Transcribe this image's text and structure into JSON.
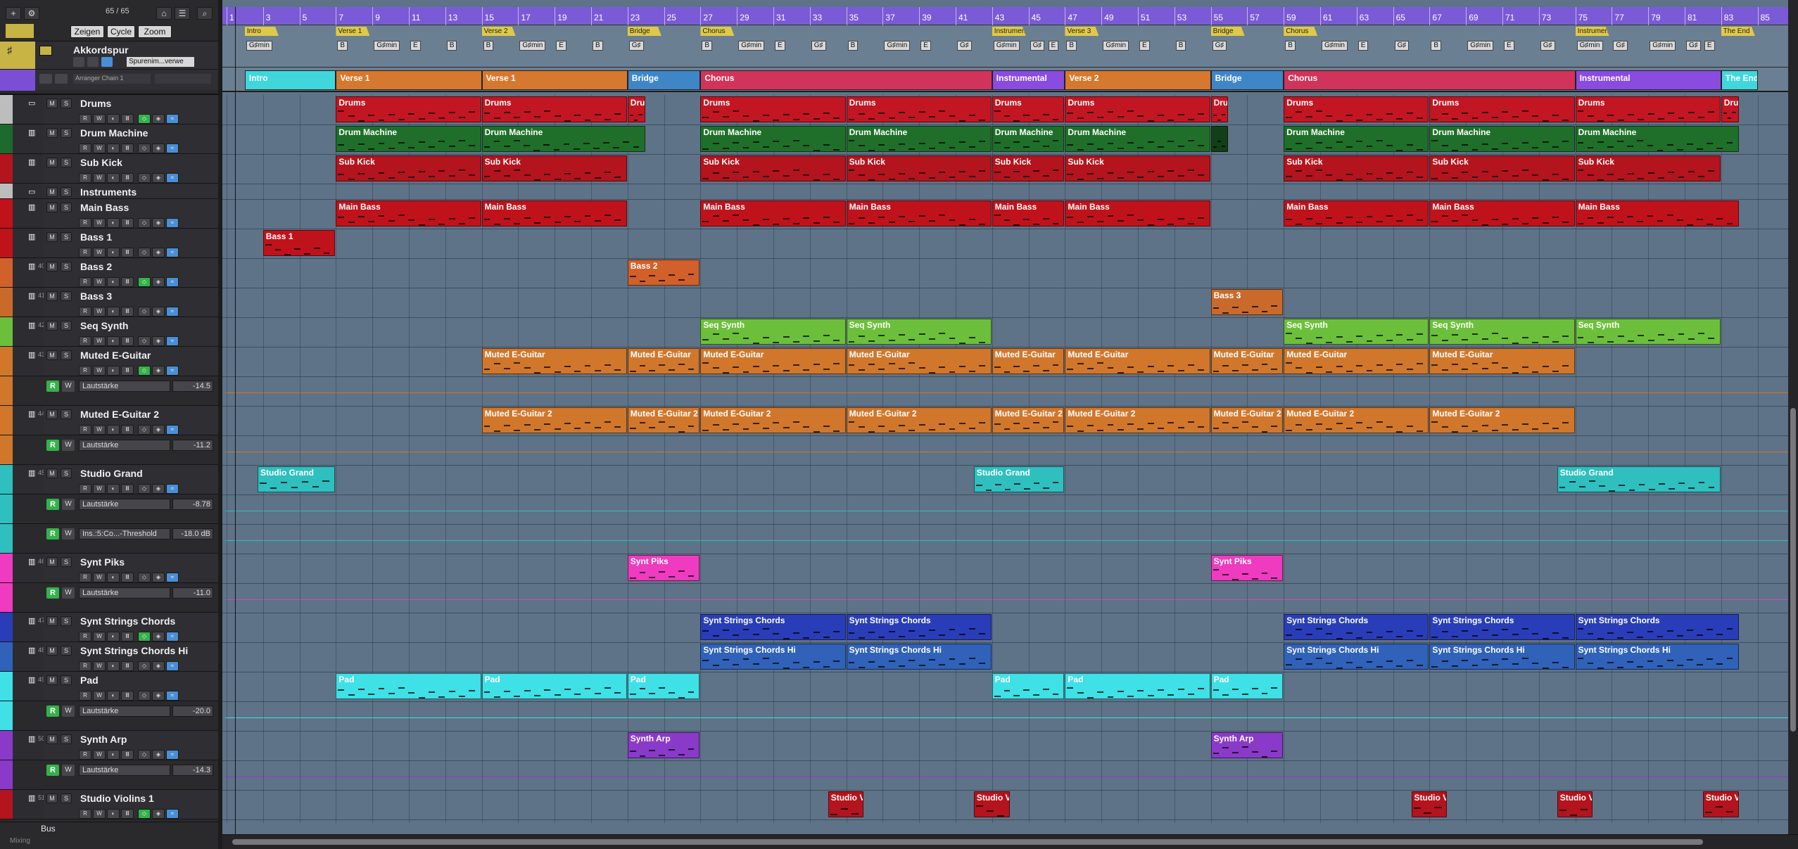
{
  "toolbar": {
    "counter": "65 / 65",
    "buttons": [
      "Zeigen",
      "Cycle",
      "Zoom"
    ]
  },
  "global_tracks": {
    "chord_track_name": "Akkordspur",
    "chord_track_option": "Spurenim...verwe",
    "arranger_chain": "Arranger Chain 1"
  },
  "ruler": {
    "bars": [
      "1",
      "3",
      "5",
      "7",
      "9",
      "11",
      "13",
      "15",
      "17",
      "19",
      "21",
      "23",
      "25",
      "27",
      "29",
      "31",
      "33",
      "35",
      "37",
      "39",
      "41",
      "43",
      "45",
      "47",
      "49",
      "51",
      "53",
      "55",
      "57",
      "59",
      "61",
      "63",
      "65",
      "67",
      "69",
      "71",
      "73",
      "75",
      "77",
      "79",
      "81",
      "83",
      "85"
    ]
  },
  "markers": [
    {
      "label": "Intro",
      "bar": 2
    },
    {
      "label": "Verse 1",
      "bar": 7
    },
    {
      "label": "Verse 2",
      "bar": 15
    },
    {
      "label": "Bridge",
      "bar": 23
    },
    {
      "label": "Chorus",
      "bar": 27
    },
    {
      "label": "Instrumental",
      "bar": 43
    },
    {
      "label": "Verse 3",
      "bar": 47
    },
    {
      "label": "Bridge",
      "bar": 55
    },
    {
      "label": "Chorus",
      "bar": 59
    },
    {
      "label": "Instrumental",
      "bar": 75
    },
    {
      "label": "The End",
      "bar": 83
    }
  ],
  "chords": [
    {
      "label": "G♯min",
      "bar": 2
    },
    {
      "label": "B",
      "bar": 7
    },
    {
      "label": "G♯min",
      "bar": 9
    },
    {
      "label": "E",
      "bar": 11
    },
    {
      "label": "B",
      "bar": 13
    },
    {
      "label": "B",
      "bar": 15
    },
    {
      "label": "G♯min",
      "bar": 17
    },
    {
      "label": "E",
      "bar": 19
    },
    {
      "label": "B",
      "bar": 21
    },
    {
      "label": "G♯",
      "bar": 23
    },
    {
      "label": "B",
      "bar": 27
    },
    {
      "label": "G♯min",
      "bar": 29
    },
    {
      "label": "E",
      "bar": 31
    },
    {
      "label": "G♯",
      "bar": 33
    },
    {
      "label": "B",
      "bar": 35
    },
    {
      "label": "G♯min",
      "bar": 37
    },
    {
      "label": "E",
      "bar": 39
    },
    {
      "label": "G♯",
      "bar": 41
    },
    {
      "label": "G♯min",
      "bar": 43
    },
    {
      "label": "G♯",
      "bar": 45
    },
    {
      "label": "E",
      "bar": 46
    },
    {
      "label": "B",
      "bar": 47
    },
    {
      "label": "G♯min",
      "bar": 49
    },
    {
      "label": "E",
      "bar": 51
    },
    {
      "label": "B",
      "bar": 53
    },
    {
      "label": "G♯",
      "bar": 55
    },
    {
      "label": "B",
      "bar": 59
    },
    {
      "label": "G♯min",
      "bar": 61
    },
    {
      "label": "E",
      "bar": 63
    },
    {
      "label": "G♯",
      "bar": 65
    },
    {
      "label": "B",
      "bar": 67
    },
    {
      "label": "G♯min",
      "bar": 69
    },
    {
      "label": "E",
      "bar": 71
    },
    {
      "label": "G♯",
      "bar": 73
    },
    {
      "label": "G♯min",
      "bar": 75
    },
    {
      "label": "G♯",
      "bar": 77
    },
    {
      "label": "G♯min",
      "bar": 79
    },
    {
      "label": "G♯",
      "bar": 81
    },
    {
      "label": "E",
      "bar": 82
    }
  ],
  "arranger_sections": [
    {
      "label": "Intro",
      "start": 2,
      "end": 7,
      "color": "#3fd7dc"
    },
    {
      "label": "Verse 1",
      "start": 7,
      "end": 15,
      "color": "#d6782e"
    },
    {
      "label": "Verse 1",
      "start": 15,
      "end": 23,
      "color": "#d6782e"
    },
    {
      "label": "Bridge",
      "start": 23,
      "end": 27,
      "color": "#3f86c9"
    },
    {
      "label": "Chorus",
      "start": 27,
      "end": 43,
      "color": "#d2335a"
    },
    {
      "label": "Instrumental",
      "start": 43,
      "end": 47,
      "color": "#8a4be0"
    },
    {
      "label": "Verse 2",
      "start": 47,
      "end": 55,
      "color": "#d6782e"
    },
    {
      "label": "Bridge",
      "start": 55,
      "end": 59,
      "color": "#3f86c9"
    },
    {
      "label": "Chorus",
      "start": 59,
      "end": 75,
      "color": "#d2335a"
    },
    {
      "label": "Instrumental",
      "start": 75,
      "end": 83,
      "color": "#8a4be0"
    },
    {
      "label": "The End",
      "start": 83,
      "end": 85,
      "color": "#3fd7dc"
    }
  ],
  "tracks": [
    {
      "name": "Drums",
      "kind": "folder",
      "color": "#bdbdbd",
      "num": "",
      "height": 42
    },
    {
      "name": "Drum Machine",
      "kind": "instrument",
      "color": "#1d6a2c",
      "num": "",
      "height": 42
    },
    {
      "name": "Sub Kick",
      "kind": "instrument",
      "color": "#b3141d",
      "num": "",
      "height": 42
    },
    {
      "name": "Instruments",
      "kind": "folder",
      "color": "#bdbdbd",
      "num": "",
      "height": 22
    },
    {
      "name": "Main Bass",
      "kind": "instrument",
      "color": "#c0121b",
      "num": "",
      "height": 42
    },
    {
      "name": "Bass 1",
      "kind": "instrument",
      "color": "#c0121b",
      "num": "",
      "height": 42
    },
    {
      "name": "Bass 2",
      "kind": "instrument",
      "color": "#d1602a",
      "num": "40",
      "height": 42
    },
    {
      "name": "Bass 3",
      "kind": "instrument",
      "color": "#c96a2c",
      "num": "41",
      "height": 42
    },
    {
      "name": "Seq Synth",
      "kind": "instrument",
      "color": "#6cbf3a",
      "num": "42",
      "height": 42
    },
    {
      "name": "Muted E-Guitar",
      "kind": "instrument",
      "color": "#d0772c",
      "num": "43",
      "height": 42
    },
    {
      "name": "Lautstärke",
      "kind": "automation",
      "value": "-14.5",
      "color": "#d0772c",
      "height": 42
    },
    {
      "name": "Muted E-Guitar 2",
      "kind": "instrument",
      "color": "#d0772c",
      "num": "44",
      "height": 42
    },
    {
      "name": "Lautstärke",
      "kind": "automation",
      "value": "-11.2",
      "color": "#d0772c",
      "height": 42
    },
    {
      "name": "Studio Grand",
      "kind": "instrument",
      "color": "#2fbfbf",
      "num": "45",
      "height": 42
    },
    {
      "name": "Lautstärke",
      "kind": "automation",
      "value": "-8.78",
      "color": "#2fbfbf",
      "height": 42
    },
    {
      "name": "Ins.:5:Co...-Threshold",
      "kind": "automation",
      "value": "-18.0 dB",
      "color": "#2fbfbf",
      "height": 42
    },
    {
      "name": "Synt Piks",
      "kind": "instrument",
      "color": "#ee3bbf",
      "num": "46",
      "height": 42
    },
    {
      "name": "Lautstärke",
      "kind": "automation",
      "value": "-11.0",
      "color": "#ee3bbf",
      "height": 42
    },
    {
      "name": "Synt Strings Chords",
      "kind": "instrument",
      "color": "#2a3db8",
      "num": "47",
      "height": 42
    },
    {
      "name": "Synt Strings Chords Hi",
      "kind": "instrument",
      "color": "#2f62b8",
      "num": "48",
      "height": 42
    },
    {
      "name": "Pad",
      "kind": "instrument",
      "color": "#3fe0e6",
      "num": "49",
      "height": 42
    },
    {
      "name": "Lautstärke",
      "kind": "automation",
      "value": "-20.0",
      "color": "#3fe0e6",
      "height": 42
    },
    {
      "name": "Synth Arp",
      "kind": "instrument",
      "color": "#8a3ac9",
      "num": "50",
      "height": 42
    },
    {
      "name": "Lautstärke",
      "kind": "automation",
      "value": "-14.3",
      "color": "#8a3ac9",
      "height": 42
    },
    {
      "name": "Studio Violins 1",
      "kind": "instrument",
      "color": "#b3141d",
      "num": "51",
      "height": 42
    }
  ],
  "footer": {
    "bus_label": "Bus",
    "mixing_label": "Mixing"
  },
  "events": [
    {
      "track": 0,
      "label": "Drums",
      "start": 7,
      "end": 15,
      "color": "#c21622"
    },
    {
      "track": 0,
      "label": "Drums",
      "start": 15,
      "end": 23,
      "color": "#c21622"
    },
    {
      "track": 0,
      "label": "Dru",
      "start": 23,
      "end": 24,
      "color": "#c21622"
    },
    {
      "track": 0,
      "label": "Drums",
      "start": 27,
      "end": 35,
      "color": "#c21622"
    },
    {
      "track": 0,
      "label": "Drums",
      "start": 35,
      "end": 43,
      "color": "#c21622"
    },
    {
      "track": 0,
      "label": "Drums",
      "start": 43,
      "end": 47,
      "color": "#c21622"
    },
    {
      "track": 0,
      "label": "Drums",
      "start": 47,
      "end": 55,
      "color": "#c21622"
    },
    {
      "track": 0,
      "label": "Dru",
      "start": 55,
      "end": 56,
      "color": "#c21622"
    },
    {
      "track": 0,
      "label": "Drums",
      "start": 59,
      "end": 67,
      "color": "#c21622"
    },
    {
      "track": 0,
      "label": "Drums",
      "start": 67,
      "end": 75,
      "color": "#c21622"
    },
    {
      "track": 0,
      "label": "Drums",
      "start": 75,
      "end": 83,
      "color": "#c21622"
    },
    {
      "track": 0,
      "label": "Dru",
      "start": 83,
      "end": 84,
      "color": "#c21622"
    },
    {
      "track": 1,
      "label": "Drum Machine",
      "start": 7,
      "end": 15,
      "color": "#1f6f2a"
    },
    {
      "track": 1,
      "label": "Drum Machine",
      "start": 15,
      "end": 24,
      "color": "#1f6f2a"
    },
    {
      "track": 1,
      "label": "Drum Machine",
      "start": 27,
      "end": 35,
      "color": "#1f6f2a"
    },
    {
      "track": 1,
      "label": "Drum Machine",
      "start": 35,
      "end": 43,
      "color": "#1f6f2a"
    },
    {
      "track": 1,
      "label": "Drum Machine",
      "start": 43,
      "end": 47,
      "color": "#1f6f2a"
    },
    {
      "track": 1,
      "label": "Drum Machine",
      "start": 47,
      "end": 55,
      "color": "#1f6f2a"
    },
    {
      "track": 1,
      "label": "",
      "start": 55,
      "end": 56,
      "color": "#123f18"
    },
    {
      "track": 1,
      "label": "Drum Machine",
      "start": 59,
      "end": 67,
      "color": "#1f6f2a"
    },
    {
      "track": 1,
      "label": "Drum Machine",
      "start": 67,
      "end": 75,
      "color": "#1f6f2a"
    },
    {
      "track": 1,
      "label": "Drum Machine",
      "start": 75,
      "end": 84,
      "color": "#1f6f2a"
    },
    {
      "track": 2,
      "label": "Sub Kick",
      "start": 7,
      "end": 15,
      "color": "#b3141d"
    },
    {
      "track": 2,
      "label": "Sub Kick",
      "start": 15,
      "end": 23,
      "color": "#b3141d"
    },
    {
      "track": 2,
      "label": "Sub Kick",
      "start": 27,
      "end": 35,
      "color": "#b3141d"
    },
    {
      "track": 2,
      "label": "Sub Kick",
      "start": 35,
      "end": 43,
      "color": "#b3141d"
    },
    {
      "track": 2,
      "label": "Sub Kick",
      "start": 43,
      "end": 47,
      "color": "#b3141d"
    },
    {
      "track": 2,
      "label": "Sub Kick",
      "start": 47,
      "end": 55,
      "color": "#b3141d"
    },
    {
      "track": 2,
      "label": "Sub Kick",
      "start": 59,
      "end": 67,
      "color": "#b3141d"
    },
    {
      "track": 2,
      "label": "Sub Kick",
      "start": 67,
      "end": 75,
      "color": "#b3141d"
    },
    {
      "track": 2,
      "label": "Sub Kick",
      "start": 75,
      "end": 83,
      "color": "#b3141d"
    },
    {
      "track": 4,
      "label": "Main Bass",
      "start": 7,
      "end": 15,
      "color": "#c0121b"
    },
    {
      "track": 4,
      "label": "Main Bass",
      "start": 15,
      "end": 23,
      "color": "#c0121b"
    },
    {
      "track": 4,
      "label": "Main Bass",
      "start": 27,
      "end": 35,
      "color": "#c0121b"
    },
    {
      "track": 4,
      "label": "Main Bass",
      "start": 35,
      "end": 43,
      "color": "#c0121b"
    },
    {
      "track": 4,
      "label": "Main Bass",
      "start": 43,
      "end": 47,
      "color": "#c0121b"
    },
    {
      "track": 4,
      "label": "Main Bass",
      "start": 47,
      "end": 55,
      "color": "#c0121b"
    },
    {
      "track": 4,
      "label": "Main Bass",
      "start": 59,
      "end": 67,
      "color": "#c0121b"
    },
    {
      "track": 4,
      "label": "Main Bass",
      "start": 67,
      "end": 75,
      "color": "#c0121b"
    },
    {
      "track": 4,
      "label": "Main Bass",
      "start": 75,
      "end": 84,
      "color": "#c0121b"
    },
    {
      "track": 5,
      "label": "Bass 1",
      "start": 3,
      "end": 7,
      "color": "#c0121b"
    },
    {
      "track": 6,
      "label": "Bass 2",
      "start": 23,
      "end": 27,
      "color": "#d1602a"
    },
    {
      "track": 7,
      "label": "Bass 3",
      "start": 55,
      "end": 59,
      "color": "#c96a2c"
    },
    {
      "track": 8,
      "label": "Seq Synth",
      "start": 27,
      "end": 35,
      "color": "#6cbf3a"
    },
    {
      "track": 8,
      "label": "Seq Synth",
      "start": 35,
      "end": 43,
      "color": "#6cbf3a"
    },
    {
      "track": 8,
      "label": "Seq Synth",
      "start": 59,
      "end": 67,
      "color": "#6cbf3a"
    },
    {
      "track": 8,
      "label": "Seq Synth",
      "start": 67,
      "end": 75,
      "color": "#6cbf3a"
    },
    {
      "track": 8,
      "label": "Seq Synth",
      "start": 75,
      "end": 83,
      "color": "#6cbf3a"
    },
    {
      "track": 9,
      "label": "Muted E-Guitar",
      "start": 15,
      "end": 23,
      "color": "#d0772c"
    },
    {
      "track": 9,
      "label": "Muted E-Guitar",
      "start": 23,
      "end": 27,
      "color": "#d0772c"
    },
    {
      "track": 9,
      "label": "Muted E-Guitar",
      "start": 27,
      "end": 35,
      "color": "#d0772c"
    },
    {
      "track": 9,
      "label": "Muted E-Guitar",
      "start": 35,
      "end": 43,
      "color": "#d0772c"
    },
    {
      "track": 9,
      "label": "Muted E-Guitar",
      "start": 43,
      "end": 47,
      "color": "#d0772c"
    },
    {
      "track": 9,
      "label": "Muted E-Guitar",
      "start": 47,
      "end": 55,
      "color": "#d0772c"
    },
    {
      "track": 9,
      "label": "Muted E-Guitar",
      "start": 55,
      "end": 59,
      "color": "#d0772c"
    },
    {
      "track": 9,
      "label": "Muted E-Guitar",
      "start": 59,
      "end": 67,
      "color": "#d0772c"
    },
    {
      "track": 9,
      "label": "Muted E-Guitar",
      "start": 67,
      "end": 75,
      "color": "#d0772c"
    },
    {
      "track": 11,
      "label": "Muted E-Guitar 2",
      "start": 15,
      "end": 23,
      "color": "#d0772c"
    },
    {
      "track": 11,
      "label": "Muted E-Guitar 2",
      "start": 23,
      "end": 27,
      "color": "#d0772c"
    },
    {
      "track": 11,
      "label": "Muted E-Guitar 2",
      "start": 27,
      "end": 35,
      "color": "#d0772c"
    },
    {
      "track": 11,
      "label": "Muted E-Guitar 2",
      "start": 35,
      "end": 43,
      "color": "#d0772c"
    },
    {
      "track": 11,
      "label": "Muted E-Guitar 2",
      "start": 43,
      "end": 47,
      "color": "#d0772c"
    },
    {
      "track": 11,
      "label": "Muted E-Guitar 2",
      "start": 47,
      "end": 55,
      "color": "#d0772c"
    },
    {
      "track": 11,
      "label": "Muted E-Guitar 2",
      "start": 55,
      "end": 59,
      "color": "#d0772c"
    },
    {
      "track": 11,
      "label": "Muted E-Guitar 2",
      "start": 59,
      "end": 67,
      "color": "#d0772c"
    },
    {
      "track": 11,
      "label": "Muted E-Guitar 2",
      "start": 67,
      "end": 75,
      "color": "#d0772c"
    },
    {
      "track": 13,
      "label": "Studio Grand",
      "start": 2.7,
      "end": 7,
      "color": "#2fbfbf"
    },
    {
      "track": 13,
      "label": "Studio Grand",
      "start": 42,
      "end": 47,
      "color": "#2fbfbf"
    },
    {
      "track": 13,
      "label": "Studio Grand",
      "start": 74,
      "end": 83,
      "color": "#2fbfbf"
    },
    {
      "track": 16,
      "label": "Synt Piks",
      "start": 23,
      "end": 27,
      "color": "#ee3bbf"
    },
    {
      "track": 16,
      "label": "Synt Piks",
      "start": 55,
      "end": 59,
      "color": "#ee3bbf"
    },
    {
      "track": 18,
      "label": "Synt Strings Chords",
      "start": 27,
      "end": 35,
      "color": "#2a3db8"
    },
    {
      "track": 18,
      "label": "Synt Strings Chords",
      "start": 35,
      "end": 43,
      "color": "#2a3db8"
    },
    {
      "track": 18,
      "label": "Synt Strings Chords",
      "start": 59,
      "end": 67,
      "color": "#2a3db8"
    },
    {
      "track": 18,
      "label": "Synt Strings Chords",
      "start": 67,
      "end": 75,
      "color": "#2a3db8"
    },
    {
      "track": 18,
      "label": "Synt Strings Chords",
      "start": 75,
      "end": 84,
      "color": "#2a3db8"
    },
    {
      "track": 19,
      "label": "Synt Strings Chords Hi",
      "start": 27,
      "end": 35,
      "color": "#2f62b8"
    },
    {
      "track": 19,
      "label": "Synt Strings Chords Hi",
      "start": 35,
      "end": 43,
      "color": "#2f62b8"
    },
    {
      "track": 19,
      "label": "Synt Strings Chords Hi",
      "start": 59,
      "end": 67,
      "color": "#2f62b8"
    },
    {
      "track": 19,
      "label": "Synt Strings Chords Hi",
      "start": 67,
      "end": 75,
      "color": "#2f62b8"
    },
    {
      "track": 19,
      "label": "Synt Strings Chords Hi",
      "start": 75,
      "end": 84,
      "color": "#2f62b8"
    },
    {
      "track": 20,
      "label": "Pad",
      "start": 7,
      "end": 15,
      "color": "#3fe0e6"
    },
    {
      "track": 20,
      "label": "Pad",
      "start": 15,
      "end": 23,
      "color": "#3fe0e6"
    },
    {
      "track": 20,
      "label": "Pad",
      "start": 23,
      "end": 27,
      "color": "#3fe0e6"
    },
    {
      "track": 20,
      "label": "Pad",
      "start": 43,
      "end": 47,
      "color": "#3fe0e6"
    },
    {
      "track": 20,
      "label": "Pad",
      "start": 47,
      "end": 55,
      "color": "#3fe0e6"
    },
    {
      "track": 20,
      "label": "Pad",
      "start": 55,
      "end": 59,
      "color": "#3fe0e6"
    },
    {
      "track": 22,
      "label": "Synth Arp",
      "start": 23,
      "end": 27,
      "color": "#8a3ac9"
    },
    {
      "track": 22,
      "label": "Synth Arp",
      "start": 55,
      "end": 59,
      "color": "#8a3ac9"
    },
    {
      "track": 24,
      "label": "Studio Vi",
      "start": 34,
      "end": 36,
      "color": "#b3141d"
    },
    {
      "track": 24,
      "label": "Studio Vi",
      "start": 42,
      "end": 44,
      "color": "#b3141d"
    },
    {
      "track": 24,
      "label": "Studio Vi",
      "start": 66,
      "end": 68,
      "color": "#b3141d"
    },
    {
      "track": 24,
      "label": "Studio Vi",
      "start": 74,
      "end": 76,
      "color": "#b3141d"
    },
    {
      "track": 24,
      "label": "Studio Vi",
      "start": 82,
      "end": 84,
      "color": "#b3141d"
    }
  ]
}
